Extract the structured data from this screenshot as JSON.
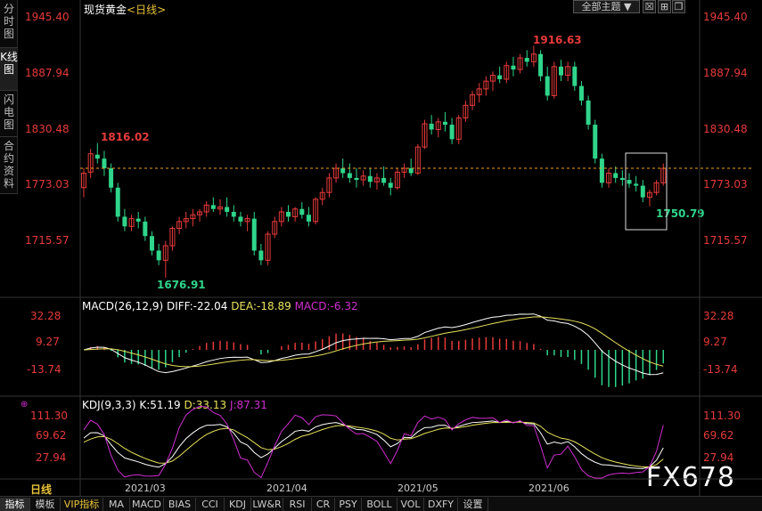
{
  "symbol": {
    "name": "现货黄金",
    "period": "<日线>"
  },
  "side_tabs": [
    "分时图",
    "K线图",
    "闪电图",
    "合约资料"
  ],
  "toolbar": {
    "theme_select": "全部主题",
    "btn_zoom": "☒",
    "btn_expand": "⊞",
    "btn_restore": "❐"
  },
  "price_axis": {
    "left": [
      "1945.40",
      "1887.94",
      "1830.48",
      "1773.03",
      "1715.57"
    ],
    "right": [
      "1945.40",
      "1887.94",
      "1830.48",
      "1773.03",
      "1715.57"
    ]
  },
  "annotations": {
    "high1": "1816.02",
    "high2": "1916.63",
    "low1": "1676.91",
    "low2": "1750.79"
  },
  "macd": {
    "legend_name": "MACD(26,12,9)",
    "diff": "DIFF:-22.04",
    "dea": "DEA:-18.89",
    "macd": "MACD:-6.32",
    "axis": [
      "32.28",
      "9.27",
      "-13.74"
    ]
  },
  "kdj": {
    "legend_name": "KDJ(9,3,3)",
    "k": "K:51.19",
    "d": "D:33.13",
    "j": "J:87.31",
    "axis": [
      "111.30",
      "69.62",
      "27.94"
    ]
  },
  "dates": [
    "2021/03",
    "2021/04",
    "2021/05",
    "2021/06"
  ],
  "period_label": "日线",
  "bottom_tabs": [
    "指标",
    "模板",
    "VIP指标",
    "MA",
    "MACD",
    "BIAS",
    "CCI",
    "KDJ",
    "LW&R",
    "RSI",
    "CR",
    "PSY",
    "BOLL",
    "VOL",
    "DXFY",
    "设置"
  ],
  "watermark": "FX678",
  "colors": {
    "up": "#e63a3a",
    "down": "#2fd58a",
    "diff": "#ffffff",
    "dea": "#e8e25a",
    "j": "#d02fd0",
    "current": "#f0a020"
  },
  "chart_data": {
    "type": "candlestick",
    "title": "现货黄金 <日线>",
    "ylim": [
      1676.91,
      1945.4
    ],
    "x": [
      "2021/03",
      "2021/04",
      "2021/05",
      "2021/06"
    ],
    "ohlc": [
      [
        1770,
        1790,
        1760,
        1785
      ],
      [
        1786,
        1810,
        1780,
        1805
      ],
      [
        1804,
        1816.02,
        1795,
        1800
      ],
      [
        1800,
        1808,
        1782,
        1790
      ],
      [
        1790,
        1795,
        1765,
        1770
      ],
      [
        1770,
        1775,
        1735,
        1740
      ],
      [
        1740,
        1748,
        1725,
        1730
      ],
      [
        1730,
        1742,
        1725,
        1738
      ],
      [
        1738,
        1745,
        1728,
        1735
      ],
      [
        1735,
        1740,
        1715,
        1720
      ],
      [
        1720,
        1725,
        1700,
        1705
      ],
      [
        1705,
        1712,
        1690,
        1695
      ],
      [
        1695,
        1715,
        1676.91,
        1710
      ],
      [
        1710,
        1730,
        1705,
        1728
      ],
      [
        1728,
        1740,
        1722,
        1735
      ],
      [
        1735,
        1745,
        1728,
        1738
      ],
      [
        1738,
        1748,
        1730,
        1742
      ],
      [
        1742,
        1748,
        1735,
        1745
      ],
      [
        1745,
        1756,
        1740,
        1752
      ],
      [
        1752,
        1760,
        1745,
        1748
      ],
      [
        1748,
        1758,
        1742,
        1750
      ],
      [
        1750,
        1760,
        1740,
        1745
      ],
      [
        1745,
        1752,
        1735,
        1740
      ],
      [
        1740,
        1745,
        1730,
        1735
      ],
      [
        1735,
        1742,
        1725,
        1738
      ],
      [
        1738,
        1745,
        1700,
        1705
      ],
      [
        1705,
        1712,
        1690,
        1695
      ],
      [
        1695,
        1725,
        1690,
        1722
      ],
      [
        1722,
        1740,
        1718,
        1735
      ],
      [
        1735,
        1750,
        1730,
        1745
      ],
      [
        1745,
        1752,
        1735,
        1740
      ],
      [
        1740,
        1750,
        1735,
        1748
      ],
      [
        1748,
        1755,
        1738,
        1742
      ],
      [
        1742,
        1750,
        1730,
        1735
      ],
      [
        1735,
        1760,
        1732,
        1758
      ],
      [
        1758,
        1770,
        1752,
        1765
      ],
      [
        1765,
        1785,
        1760,
        1780
      ],
      [
        1780,
        1795,
        1775,
        1790
      ],
      [
        1790,
        1800,
        1780,
        1785
      ],
      [
        1785,
        1795,
        1775,
        1780
      ],
      [
        1780,
        1790,
        1770,
        1778
      ],
      [
        1778,
        1788,
        1772,
        1782
      ],
      [
        1782,
        1790,
        1770,
        1776
      ],
      [
        1776,
        1785,
        1768,
        1780
      ],
      [
        1780,
        1792,
        1772,
        1775
      ],
      [
        1775,
        1780,
        1762,
        1770
      ],
      [
        1770,
        1790,
        1768,
        1786
      ],
      [
        1786,
        1795,
        1780,
        1790
      ],
      [
        1790,
        1800,
        1782,
        1785
      ],
      [
        1785,
        1815,
        1783,
        1812
      ],
      [
        1812,
        1840,
        1810,
        1836
      ],
      [
        1836,
        1845,
        1825,
        1830
      ],
      [
        1830,
        1842,
        1822,
        1838
      ],
      [
        1838,
        1848,
        1828,
        1835
      ],
      [
        1835,
        1842,
        1815,
        1820
      ],
      [
        1820,
        1845,
        1815,
        1842
      ],
      [
        1842,
        1860,
        1838,
        1855
      ],
      [
        1855,
        1870,
        1850,
        1866
      ],
      [
        1866,
        1878,
        1858,
        1872
      ],
      [
        1872,
        1885,
        1865,
        1880
      ],
      [
        1880,
        1890,
        1870,
        1886
      ],
      [
        1886,
        1895,
        1878,
        1882
      ],
      [
        1882,
        1900,
        1878,
        1896
      ],
      [
        1896,
        1905,
        1885,
        1892
      ],
      [
        1892,
        1908,
        1888,
        1904
      ],
      [
        1904,
        1912,
        1895,
        1900
      ],
      [
        1900,
        1916.63,
        1895,
        1908
      ],
      [
        1908,
        1912,
        1880,
        1885
      ],
      [
        1885,
        1895,
        1860,
        1865
      ],
      [
        1865,
        1900,
        1862,
        1895
      ],
      [
        1895,
        1902,
        1880,
        1886
      ],
      [
        1886,
        1900,
        1880,
        1895
      ],
      [
        1895,
        1900,
        1870,
        1875
      ],
      [
        1875,
        1880,
        1855,
        1860
      ],
      [
        1860,
        1865,
        1830,
        1835
      ],
      [
        1835,
        1840,
        1795,
        1800
      ],
      [
        1800,
        1805,
        1770,
        1775
      ],
      [
        1775,
        1790,
        1770,
        1785
      ],
      [
        1785,
        1792,
        1775,
        1780
      ],
      [
        1780,
        1788,
        1772,
        1778
      ],
      [
        1778,
        1785,
        1770,
        1774
      ],
      [
        1774,
        1782,
        1766,
        1772
      ],
      [
        1772,
        1778,
        1755,
        1760
      ],
      [
        1760,
        1768,
        1750.79,
        1765
      ],
      [
        1765,
        1778,
        1762,
        1775
      ],
      [
        1775,
        1795,
        1772,
        1790
      ]
    ],
    "macd_diff": [],
    "kdj_k": []
  }
}
